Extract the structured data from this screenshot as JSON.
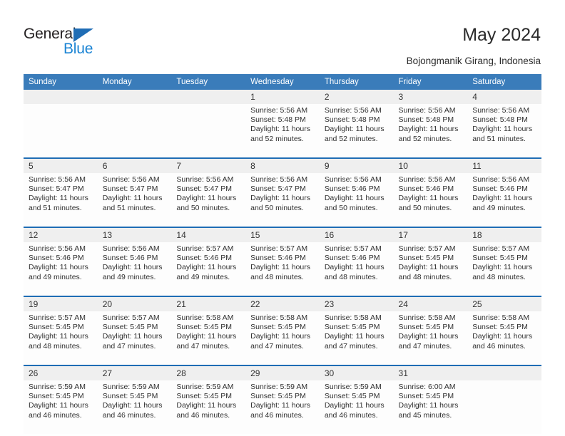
{
  "brand": {
    "name_part1": "General",
    "name_part2": "Blue",
    "triangle_icon": "triangle-icon",
    "accent_blue": "#1f6db5",
    "light_blue": "#1b84d4"
  },
  "header": {
    "title": "May 2024",
    "subtitle": "Bojongmanik Girang, Indonesia"
  },
  "calendar": {
    "header_bg": "#3a7cba",
    "daynum_bg": "#efefef",
    "separator_color": "#1f6db5",
    "weekdays": [
      "Sunday",
      "Monday",
      "Tuesday",
      "Wednesday",
      "Thursday",
      "Friday",
      "Saturday"
    ],
    "weeks": [
      [
        {
          "day": "",
          "sunrise": "",
          "sunset": "",
          "daylight": ""
        },
        {
          "day": "",
          "sunrise": "",
          "sunset": "",
          "daylight": ""
        },
        {
          "day": "",
          "sunrise": "",
          "sunset": "",
          "daylight": ""
        },
        {
          "day": "1",
          "sunrise": "Sunrise: 5:56 AM",
          "sunset": "Sunset: 5:48 PM",
          "daylight": "Daylight: 11 hours and 52 minutes."
        },
        {
          "day": "2",
          "sunrise": "Sunrise: 5:56 AM",
          "sunset": "Sunset: 5:48 PM",
          "daylight": "Daylight: 11 hours and 52 minutes."
        },
        {
          "day": "3",
          "sunrise": "Sunrise: 5:56 AM",
          "sunset": "Sunset: 5:48 PM",
          "daylight": "Daylight: 11 hours and 52 minutes."
        },
        {
          "day": "4",
          "sunrise": "Sunrise: 5:56 AM",
          "sunset": "Sunset: 5:48 PM",
          "daylight": "Daylight: 11 hours and 51 minutes."
        }
      ],
      [
        {
          "day": "5",
          "sunrise": "Sunrise: 5:56 AM",
          "sunset": "Sunset: 5:47 PM",
          "daylight": "Daylight: 11 hours and 51 minutes."
        },
        {
          "day": "6",
          "sunrise": "Sunrise: 5:56 AM",
          "sunset": "Sunset: 5:47 PM",
          "daylight": "Daylight: 11 hours and 51 minutes."
        },
        {
          "day": "7",
          "sunrise": "Sunrise: 5:56 AM",
          "sunset": "Sunset: 5:47 PM",
          "daylight": "Daylight: 11 hours and 50 minutes."
        },
        {
          "day": "8",
          "sunrise": "Sunrise: 5:56 AM",
          "sunset": "Sunset: 5:47 PM",
          "daylight": "Daylight: 11 hours and 50 minutes."
        },
        {
          "day": "9",
          "sunrise": "Sunrise: 5:56 AM",
          "sunset": "Sunset: 5:46 PM",
          "daylight": "Daylight: 11 hours and 50 minutes."
        },
        {
          "day": "10",
          "sunrise": "Sunrise: 5:56 AM",
          "sunset": "Sunset: 5:46 PM",
          "daylight": "Daylight: 11 hours and 50 minutes."
        },
        {
          "day": "11",
          "sunrise": "Sunrise: 5:56 AM",
          "sunset": "Sunset: 5:46 PM",
          "daylight": "Daylight: 11 hours and 49 minutes."
        }
      ],
      [
        {
          "day": "12",
          "sunrise": "Sunrise: 5:56 AM",
          "sunset": "Sunset: 5:46 PM",
          "daylight": "Daylight: 11 hours and 49 minutes."
        },
        {
          "day": "13",
          "sunrise": "Sunrise: 5:56 AM",
          "sunset": "Sunset: 5:46 PM",
          "daylight": "Daylight: 11 hours and 49 minutes."
        },
        {
          "day": "14",
          "sunrise": "Sunrise: 5:57 AM",
          "sunset": "Sunset: 5:46 PM",
          "daylight": "Daylight: 11 hours and 49 minutes."
        },
        {
          "day": "15",
          "sunrise": "Sunrise: 5:57 AM",
          "sunset": "Sunset: 5:46 PM",
          "daylight": "Daylight: 11 hours and 48 minutes."
        },
        {
          "day": "16",
          "sunrise": "Sunrise: 5:57 AM",
          "sunset": "Sunset: 5:46 PM",
          "daylight": "Daylight: 11 hours and 48 minutes."
        },
        {
          "day": "17",
          "sunrise": "Sunrise: 5:57 AM",
          "sunset": "Sunset: 5:45 PM",
          "daylight": "Daylight: 11 hours and 48 minutes."
        },
        {
          "day": "18",
          "sunrise": "Sunrise: 5:57 AM",
          "sunset": "Sunset: 5:45 PM",
          "daylight": "Daylight: 11 hours and 48 minutes."
        }
      ],
      [
        {
          "day": "19",
          "sunrise": "Sunrise: 5:57 AM",
          "sunset": "Sunset: 5:45 PM",
          "daylight": "Daylight: 11 hours and 48 minutes."
        },
        {
          "day": "20",
          "sunrise": "Sunrise: 5:57 AM",
          "sunset": "Sunset: 5:45 PM",
          "daylight": "Daylight: 11 hours and 47 minutes."
        },
        {
          "day": "21",
          "sunrise": "Sunrise: 5:58 AM",
          "sunset": "Sunset: 5:45 PM",
          "daylight": "Daylight: 11 hours and 47 minutes."
        },
        {
          "day": "22",
          "sunrise": "Sunrise: 5:58 AM",
          "sunset": "Sunset: 5:45 PM",
          "daylight": "Daylight: 11 hours and 47 minutes."
        },
        {
          "day": "23",
          "sunrise": "Sunrise: 5:58 AM",
          "sunset": "Sunset: 5:45 PM",
          "daylight": "Daylight: 11 hours and 47 minutes."
        },
        {
          "day": "24",
          "sunrise": "Sunrise: 5:58 AM",
          "sunset": "Sunset: 5:45 PM",
          "daylight": "Daylight: 11 hours and 47 minutes."
        },
        {
          "day": "25",
          "sunrise": "Sunrise: 5:58 AM",
          "sunset": "Sunset: 5:45 PM",
          "daylight": "Daylight: 11 hours and 46 minutes."
        }
      ],
      [
        {
          "day": "26",
          "sunrise": "Sunrise: 5:59 AM",
          "sunset": "Sunset: 5:45 PM",
          "daylight": "Daylight: 11 hours and 46 minutes."
        },
        {
          "day": "27",
          "sunrise": "Sunrise: 5:59 AM",
          "sunset": "Sunset: 5:45 PM",
          "daylight": "Daylight: 11 hours and 46 minutes."
        },
        {
          "day": "28",
          "sunrise": "Sunrise: 5:59 AM",
          "sunset": "Sunset: 5:45 PM",
          "daylight": "Daylight: 11 hours and 46 minutes."
        },
        {
          "day": "29",
          "sunrise": "Sunrise: 5:59 AM",
          "sunset": "Sunset: 5:45 PM",
          "daylight": "Daylight: 11 hours and 46 minutes."
        },
        {
          "day": "30",
          "sunrise": "Sunrise: 5:59 AM",
          "sunset": "Sunset: 5:45 PM",
          "daylight": "Daylight: 11 hours and 46 minutes."
        },
        {
          "day": "31",
          "sunrise": "Sunrise: 6:00 AM",
          "sunset": "Sunset: 5:45 PM",
          "daylight": "Daylight: 11 hours and 45 minutes."
        },
        {
          "day": "",
          "sunrise": "",
          "sunset": "",
          "daylight": ""
        }
      ]
    ]
  }
}
